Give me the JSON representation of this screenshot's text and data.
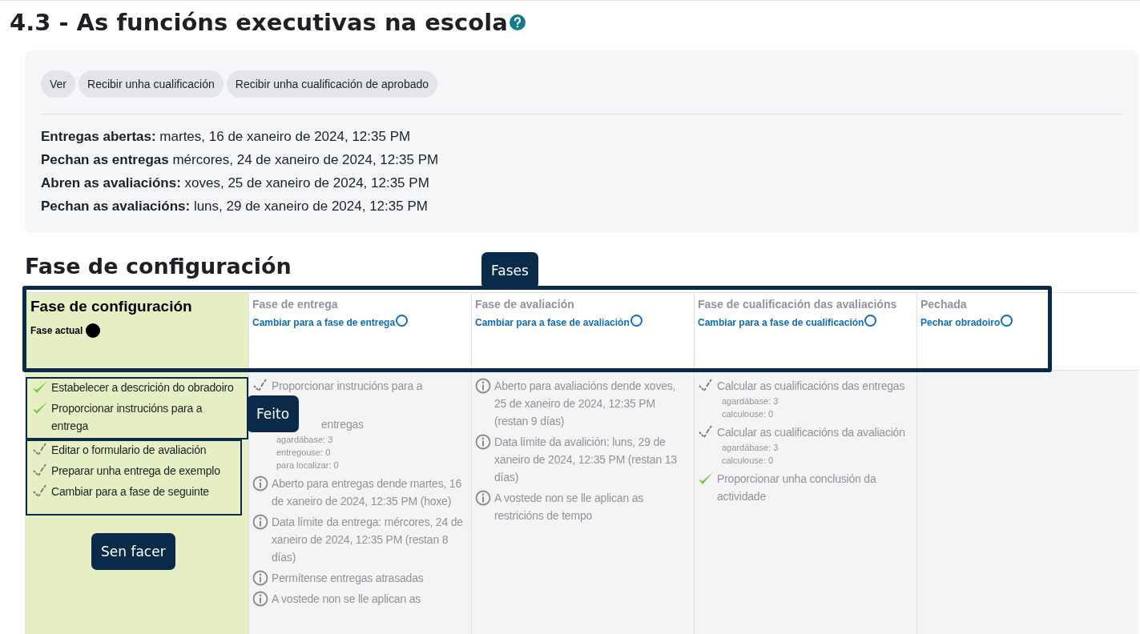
{
  "title": "4.3 - As funcións executivas na escola",
  "completion_buttons": [
    "Ver",
    "Recibir unha cualificación",
    "Recibir unha cualificación de aprobado"
  ],
  "dates": [
    "**Entregas abertas:** martes, 16 de xaneiro de 2024, 12:35 PM",
    "**Pechan as entregas** mércores, 24 de xaneiro de 2024, 12:35 PM",
    "**Abren as avaliacións:** xoves, 25 de xaneiro de 2024, 12:35 PM",
    "**Pechan as avaliacións:** luns, 29 de xaneiro de 2024, 12:35 PM"
  ],
  "section_heading": "Fase de configuración",
  "phases": [
    {
      "name": "Fase de configuración",
      "current": true,
      "status": "Fase actual",
      "tasks": [
        {
          "kind": "done",
          "text": "Estabelecer a descrición do obradoiro"
        },
        {
          "kind": "done",
          "text": "Proporcionar instrucións para a entrega"
        },
        {
          "kind": "todo",
          "text": "Editar o formulario de avaliación"
        },
        {
          "kind": "todo",
          "text": "Preparar unha entrega de exemplo"
        },
        {
          "kind": "todo",
          "text": "Cambiar para a fase de seguinte"
        }
      ]
    },
    {
      "name": "Fase de entrega",
      "current": false,
      "action": "Cambiar para a fase de entrega",
      "tasks": [
        {
          "kind": "todo",
          "text": "Proporcionar instrucións para a"
        },
        {
          "kind": "todo",
          "text": "entregas",
          "details": [
            "agardábase: 3",
            "entregouse: 0",
            "para localizar: 0"
          ]
        },
        {
          "kind": "info",
          "text": "Aberto para entregas dende martes, 16 de xaneiro de 2024, 12:35 PM (hoxe)"
        },
        {
          "kind": "info",
          "text": "Data límite da entrega: mércores, 24 de xaneiro de 2024, 12:35 PM (restan 8 días)"
        },
        {
          "kind": "info",
          "text": "Permítense entregas atrasadas"
        },
        {
          "kind": "info",
          "text": "A vostede non se lle aplican as"
        }
      ]
    },
    {
      "name": "Fase de avaliación",
      "current": false,
      "action": "Cambiar para a fase de avaliación",
      "tasks": [
        {
          "kind": "info",
          "text": "Aberto para avaliacións dende xoves, 25 de xaneiro de 2024, 12:35 PM (restan 9 días)"
        },
        {
          "kind": "info",
          "text": "Data límite da avalición: luns, 29 de xaneiro de 2024, 12:35 PM (restan 13 días)"
        },
        {
          "kind": "info",
          "text": "A vostede non se lle aplican as restricións de tempo"
        }
      ]
    },
    {
      "name": "Fase de cualificación das avaliacións",
      "current": false,
      "action": "Cambiar para a fase de cualificación",
      "tasks": [
        {
          "kind": "todo",
          "text": "Calcular as cualificacións das entregas",
          "details": [
            "agardábase: 3",
            "calculouse: 0"
          ]
        },
        {
          "kind": "todo",
          "text": "Calcular as cualificacións da avaliación",
          "details": [
            "agardábase: 3",
            "calculouse: 0"
          ]
        },
        {
          "kind": "done",
          "text": "Proporcionar unha conclusión da actividade"
        }
      ]
    },
    {
      "name": "Pechada",
      "current": false,
      "action": "Pechar obradoiro"
    }
  ],
  "callouts": [
    "Fases",
    "Feito",
    "Sen facer"
  ]
}
